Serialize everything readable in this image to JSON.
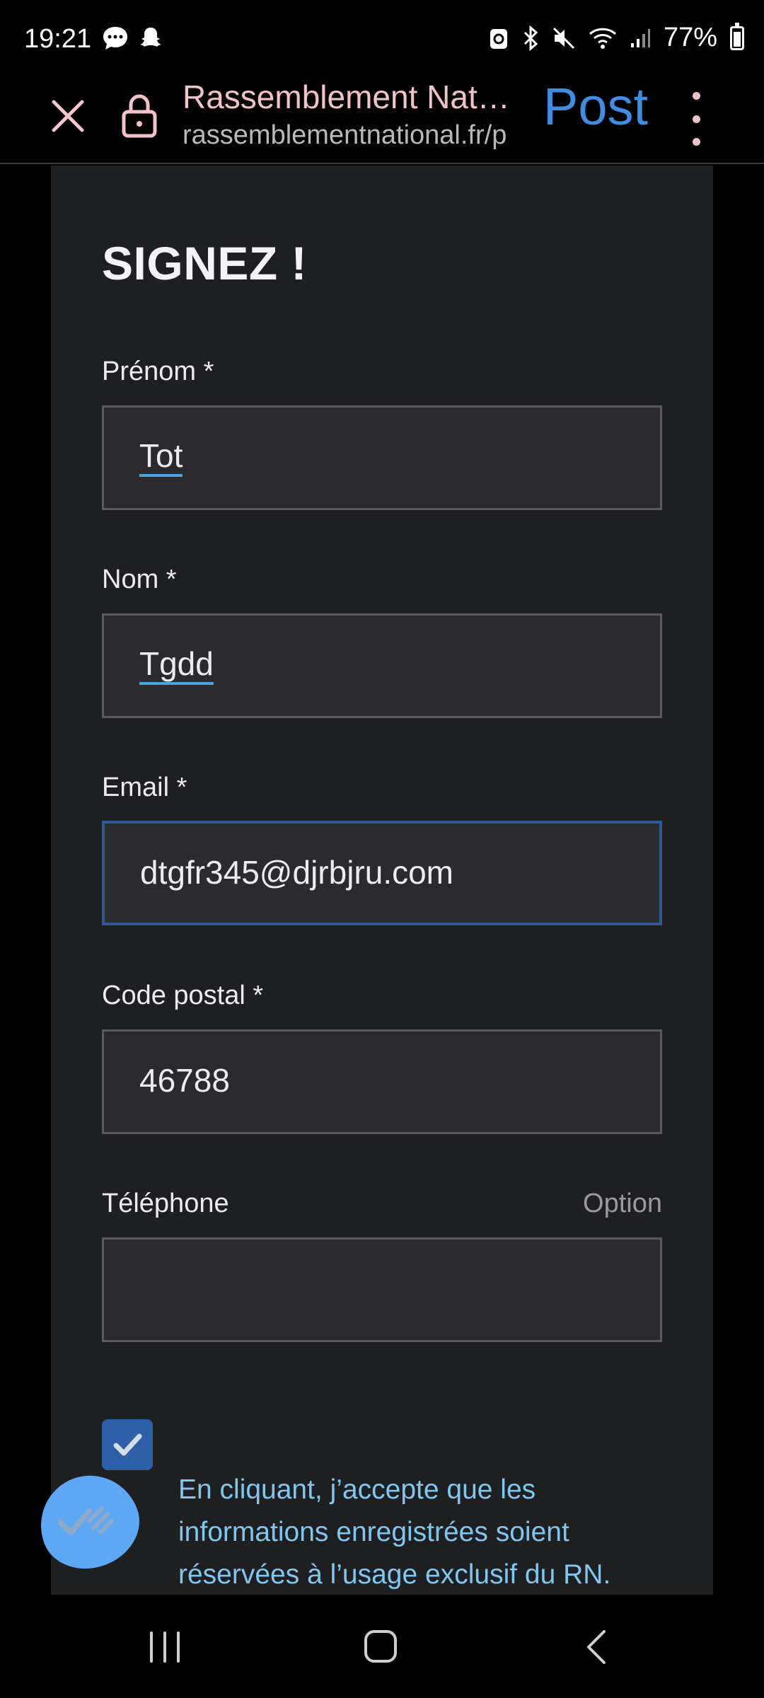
{
  "status_bar": {
    "time": "19:21",
    "left_icons": [
      "chat-bubble-icon",
      "snapchat-icon"
    ],
    "right_icons": [
      "data-saver-icon",
      "bluetooth-icon",
      "mute-icon",
      "wifi-icon",
      "signal-icon",
      "battery-icon"
    ],
    "battery_percent": "77%"
  },
  "browser": {
    "title": "Rassemblement Nat…",
    "url": "rassemblementnational.fr/p",
    "action_label": "Post",
    "title_color": "#f3c2c8",
    "action_color": "#3f8ee6"
  },
  "form": {
    "heading": "SIGNEZ !",
    "fields": [
      {
        "label": "Prénom *",
        "value": "Tot",
        "optional": ""
      },
      {
        "label": "Nom *",
        "value": "Tgdd",
        "optional": ""
      },
      {
        "label": "Email *",
        "value": "dtgfr345@djrbjru.com",
        "optional": ""
      },
      {
        "label": "Code postal *",
        "value": "46788",
        "optional": ""
      },
      {
        "label": "Téléphone",
        "value": "",
        "optional": "Option"
      }
    ],
    "consent_checked": true,
    "consent_text": "En cliquant, j’accepte que les informations enregistrées soient réservées à l’usage exclusif du RN."
  },
  "colors": {
    "panel_bg": "#1e1f21",
    "field_bg": "#2b2b2d",
    "focus_border": "#2d5a94",
    "link_blue": "#7fc7ef",
    "fab_blue": "#5ca8f5"
  }
}
